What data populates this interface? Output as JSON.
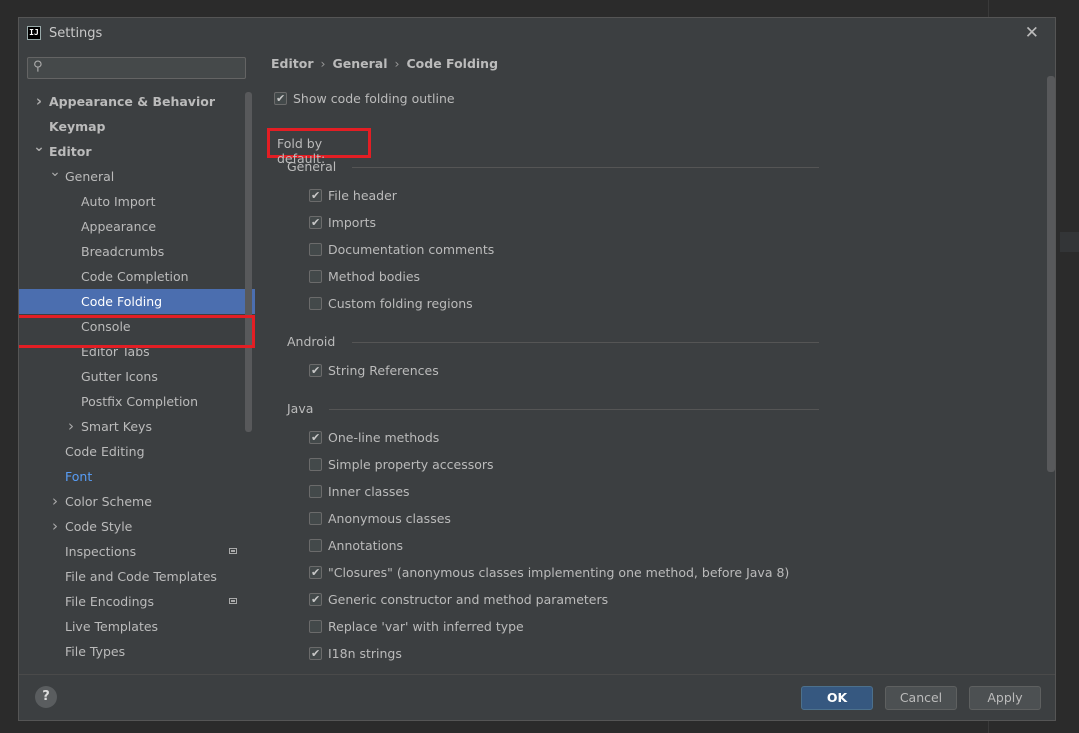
{
  "window": {
    "title": "Settings",
    "app_icon_text": "IJ"
  },
  "search": {
    "placeholder": ""
  },
  "tree": [
    {
      "label": "Appearance & Behavior",
      "level": 0,
      "arrow": "right",
      "bold": true
    },
    {
      "label": "Keymap",
      "level": 0,
      "bold": true
    },
    {
      "label": "Editor",
      "level": 0,
      "arrow": "down",
      "bold": true
    },
    {
      "label": "General",
      "level": 1,
      "arrow": "down"
    },
    {
      "label": "Auto Import",
      "level": 2
    },
    {
      "label": "Appearance",
      "level": 2
    },
    {
      "label": "Breadcrumbs",
      "level": 2
    },
    {
      "label": "Code Completion",
      "level": 2
    },
    {
      "label": "Code Folding",
      "level": 2,
      "selected": true
    },
    {
      "label": "Console",
      "level": 2
    },
    {
      "label": "Editor Tabs",
      "level": 2
    },
    {
      "label": "Gutter Icons",
      "level": 2
    },
    {
      "label": "Postfix Completion",
      "level": 2
    },
    {
      "label": "Smart Keys",
      "level": 2,
      "arrow": "right"
    },
    {
      "label": "Code Editing",
      "level": 1
    },
    {
      "label": "Font",
      "level": 1,
      "link": true
    },
    {
      "label": "Color Scheme",
      "level": 1,
      "arrow": "right"
    },
    {
      "label": "Code Style",
      "level": 1,
      "arrow": "right"
    },
    {
      "label": "Inspections",
      "level": 1,
      "module": true
    },
    {
      "label": "File and Code Templates",
      "level": 1
    },
    {
      "label": "File Encodings",
      "level": 1,
      "module": true
    },
    {
      "label": "Live Templates",
      "level": 1
    },
    {
      "label": "File Types",
      "level": 1
    }
  ],
  "breadcrumb": [
    "Editor",
    "General",
    "Code Folding"
  ],
  "show_outline": {
    "label": "Show code folding outline",
    "checked": true
  },
  "fold_by_default": "Fold by default:",
  "sections": [
    {
      "title": "General",
      "items": [
        {
          "label": "File header",
          "checked": true
        },
        {
          "label": "Imports",
          "checked": true
        },
        {
          "label": "Documentation comments",
          "checked": false
        },
        {
          "label": "Method bodies",
          "checked": false
        },
        {
          "label": "Custom folding regions",
          "checked": false
        }
      ]
    },
    {
      "title": "Android",
      "items": [
        {
          "label": "String References",
          "checked": true
        }
      ]
    },
    {
      "title": "Java",
      "items": [
        {
          "label": "One-line methods",
          "checked": true
        },
        {
          "label": "Simple property accessors",
          "checked": false
        },
        {
          "label": "Inner classes",
          "checked": false
        },
        {
          "label": "Anonymous classes",
          "checked": false
        },
        {
          "label": "Annotations",
          "checked": false
        },
        {
          "label": "\"Closures\" (anonymous classes implementing one method, before Java 8)",
          "checked": true
        },
        {
          "label": "Generic constructor and method parameters",
          "checked": true
        },
        {
          "label": "Replace 'var' with inferred type",
          "checked": false
        },
        {
          "label": "I18n strings",
          "checked": true
        }
      ]
    }
  ],
  "buttons": {
    "help": "?",
    "ok": "OK",
    "cancel": "Cancel",
    "apply": "Apply"
  }
}
